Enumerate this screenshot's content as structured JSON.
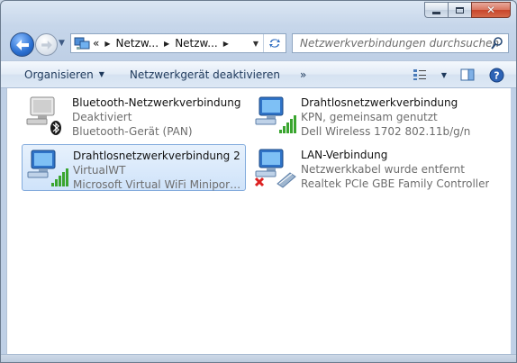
{
  "window": {
    "caption_buttons": {
      "minimize": "minimize",
      "maximize": "maximize",
      "close": "close"
    }
  },
  "navigation": {
    "breadcrumb": [
      "«",
      "Netzw...",
      "Netzw..."
    ],
    "search_placeholder": "Netzwerkverbindungen durchsuchen"
  },
  "toolbar": {
    "organize_label": "Organisieren",
    "disable_device_label": "Netzwerkgerät deaktivieren",
    "more_label": "»"
  },
  "connections": [
    {
      "name": "Bluetooth-Netzwerkverbindung",
      "status": "Deaktiviert",
      "device": "Bluetooth-Gerät (PAN)",
      "icon": "bluetooth-network-icon",
      "selected": false
    },
    {
      "name": "Drahtlosnetzwerkverbindung",
      "status": "KPN, gemeinsam genutzt",
      "device": "Dell Wireless 1702 802.11b/g/n",
      "icon": "wireless-network-icon",
      "selected": false
    },
    {
      "name": "Drahtlosnetzwerkverbindung 2",
      "status": "VirtualWT",
      "device": "Microsoft Virtual WiFi Miniport A...",
      "icon": "wireless-network-icon",
      "selected": true
    },
    {
      "name": "LAN-Verbindung",
      "status": "Netzwerkkabel wurde entfernt",
      "device": "Realtek PCIe GBE Family Controller",
      "icon": "lan-disconnected-icon",
      "selected": false
    }
  ],
  "colors": {
    "accent": "#1e395b",
    "selection": "#cfe3fa",
    "signal": "#3aa52f",
    "error": "#d22"
  }
}
